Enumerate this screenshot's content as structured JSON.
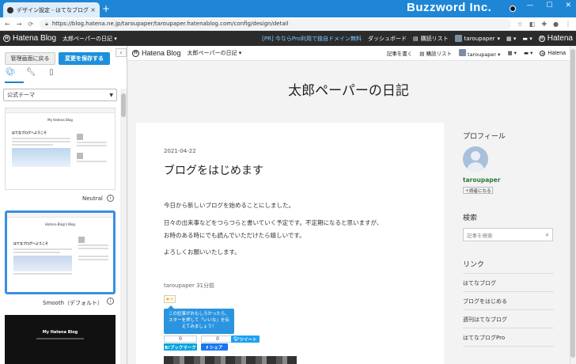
{
  "browser": {
    "tab_title": "デザイン設定 - はてなブログ",
    "tab_close": "×",
    "new_tab": "+",
    "window_brand": "Buzzword Inc.",
    "window_controls": [
      "—",
      "☐",
      "✕"
    ],
    "url": "https://blog.hatena.ne.jp/taroupaper/taroupaper.hatenablog.com/config/design/detail"
  },
  "hatena_bar": {
    "logo": "Hatena Blog",
    "blog_name": "太郎ペーパーの日記",
    "promo": "[PR] 今ならPro利用で独自ドメイン無料",
    "dashboard": "ダッシュボード",
    "reading_list": "購読リスト",
    "user": "taroupaper",
    "hatena": "Hatena"
  },
  "sidebar": {
    "back_button": "管理画面に戻る",
    "save_button": "変更を保存する",
    "collapse": "‹",
    "theme_select": "公式テーマ",
    "themes": [
      {
        "label": "Neutral",
        "preview_title": "My Hatena Blog",
        "post_title": "はてなブログへようこそ"
      },
      {
        "label": "Smooth（デフォルト）",
        "preview_title": "Hatena Blog's Blog",
        "post_title": "はてなブログへようこそ"
      },
      {
        "label": "",
        "preview_title": "My Hatena Blog",
        "post_title": ""
      }
    ],
    "info_icon": "i"
  },
  "preview": {
    "nav": {
      "logo": "Hatena Blog",
      "blog_name": "太郎ペーパーの日記",
      "write": "記事を書く",
      "reading_list": "購読リスト",
      "user": "taroupaper",
      "hatena": "Hatena"
    },
    "blog_title": "太郎ペーパーの日記",
    "post": {
      "date": "2021-04-22",
      "title": "ブログをはじめます",
      "paragraphs": [
        "今日から新しいブログを始めることにしました。",
        "日々の出来事などをつらつらと書いていく予定です。不定期になると思いますが、",
        "お時のある時にでも読んでいただけたら嬉しいです。",
        "よろしくお願いいたします。"
      ],
      "author_line": "taroupaper 31分前",
      "star": "★+",
      "tooltip": "この記事がおもしろかったら、スターを押して「いいな」を伝えてみましょう！",
      "counts": [
        "0",
        "0"
      ],
      "share_bookmark": "B!ブックマーク",
      "share_facebook": "f シェア",
      "share_tweet": "ツイート"
    },
    "sidebar": {
      "profile_heading": "プロフィール",
      "profile_name": "taroupaper",
      "reader_button": "＋読者になる",
      "search_heading": "検索",
      "search_placeholder": "記事を検索",
      "links_heading": "リンク",
      "links": [
        "はてなブログ",
        "ブログをはじめる",
        "週刊はてなブログ",
        "はてなブログPro"
      ]
    }
  }
}
